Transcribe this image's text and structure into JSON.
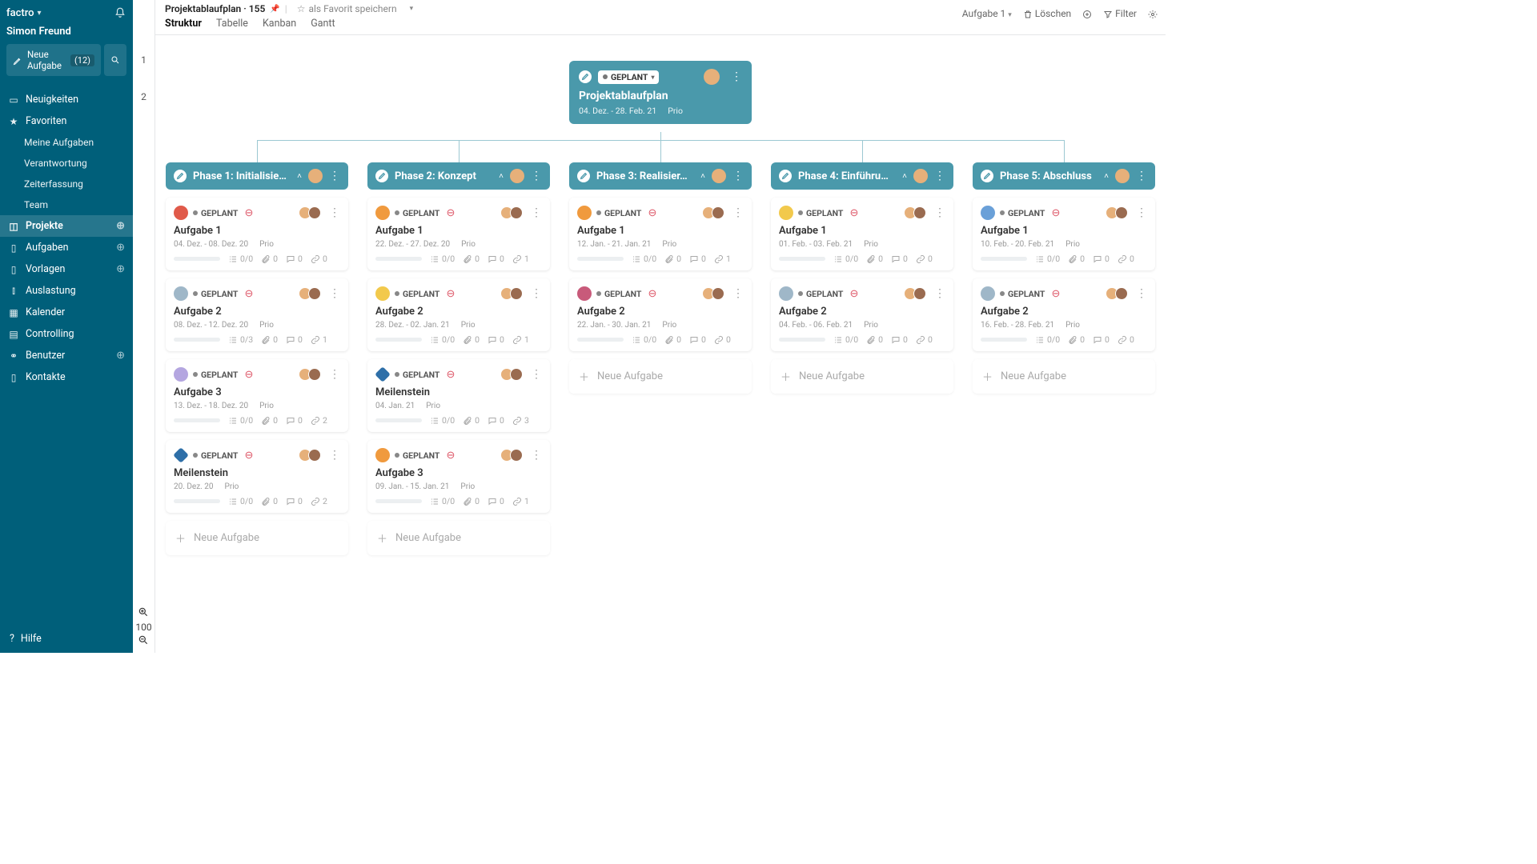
{
  "sidebar": {
    "brand": "factro",
    "user": "Simon Freund",
    "new_task": "Neue Aufgabe",
    "new_count": "(12)",
    "nav": {
      "neuigkeiten": "Neuigkeiten",
      "favoriten": "Favoriten",
      "meine": "Meine Aufgaben",
      "verantwortung": "Verantwortung",
      "zeit": "Zeiterfassung",
      "team": "Team",
      "projekte": "Projekte",
      "aufgaben": "Aufgaben",
      "vorlagen": "Vorlagen",
      "auslastung": "Auslastung",
      "kalender": "Kalender",
      "controlling": "Controlling",
      "benutzer": "Benutzer",
      "kontakte": "Kontakte"
    },
    "help": "Hilfe"
  },
  "ruler": {
    "r1": "1",
    "r2": "2",
    "zoom": "100"
  },
  "topbar": {
    "title": "Projektablaufplan · 155",
    "fav": "als Favorit speichern",
    "tabs": {
      "struktur": "Struktur",
      "tabelle": "Tabelle",
      "kanban": "Kanban",
      "gantt": "Gantt"
    },
    "task_label": "Aufgabe 1",
    "del": "Löschen",
    "filter": "Filter"
  },
  "root": {
    "status": "GEPLANT",
    "title": "Projektablaufplan",
    "dates": "04. Dez. - 28. Feb. 21",
    "prio": "Prio"
  },
  "status_label": "GEPLANT",
  "new_task_label": "Neue Aufgabe",
  "prio": "Prio",
  "phases": [
    {
      "title": "Phase 1: Initialisie…",
      "cards": [
        {
          "ico": "#e05a4a",
          "shape": "circle",
          "title": "Aufgabe 1",
          "dates": "04. Dez. - 08. Dez. 20",
          "sub": "0/0",
          "att": "0",
          "cmt": "0",
          "lnk": "0"
        },
        {
          "ico": "#9fb7c8",
          "shape": "circle",
          "title": "Aufgabe 2",
          "dates": "08. Dez. - 12. Dez. 20",
          "sub": "0/3",
          "att": "0",
          "cmt": "0",
          "lnk": "1"
        },
        {
          "ico": "#b4a6e0",
          "shape": "circle",
          "title": "Aufgabe 3",
          "dates": "13. Dez. - 18. Dez. 20",
          "sub": "0/0",
          "att": "0",
          "cmt": "0",
          "lnk": "2"
        },
        {
          "ico": "#2e6fa8",
          "shape": "diamond",
          "title": "Meilenstein",
          "dates": "20. Dez. 20",
          "sub": "0/0",
          "att": "0",
          "cmt": "0",
          "lnk": "2",
          "single_date": true
        }
      ]
    },
    {
      "title": "Phase 2: Konzept",
      "cards": [
        {
          "ico": "#f09a3e",
          "shape": "circle",
          "title": "Aufgabe 1",
          "dates": "22. Dez. - 27. Dez. 20",
          "sub": "0/0",
          "att": "0",
          "cmt": "0",
          "lnk": "1"
        },
        {
          "ico": "#f2c94c",
          "shape": "circle",
          "title": "Aufgabe 2",
          "dates": "28. Dez. - 02. Jan. 21",
          "sub": "0/0",
          "att": "0",
          "cmt": "0",
          "lnk": "1"
        },
        {
          "ico": "#2e6fa8",
          "shape": "diamond",
          "title": "Meilenstein",
          "dates": "04. Jan. 21",
          "sub": "0/0",
          "att": "0",
          "cmt": "0",
          "lnk": "3",
          "single_date": true
        },
        {
          "ico": "#f09a3e",
          "shape": "circle",
          "title": "Aufgabe 3",
          "dates": "09. Jan. - 15. Jan. 21",
          "sub": "0/0",
          "att": "0",
          "cmt": "0",
          "lnk": "1"
        }
      ]
    },
    {
      "title": "Phase 3: Realisier…",
      "cards": [
        {
          "ico": "#f09a3e",
          "shape": "circle",
          "title": "Aufgabe 1",
          "dates": "12. Jan. - 21. Jan. 21",
          "sub": "0/0",
          "att": "0",
          "cmt": "0",
          "lnk": "1"
        },
        {
          "ico": "#c85a7a",
          "shape": "circle",
          "title": "Aufgabe 2",
          "dates": "22. Jan. - 30. Jan. 21",
          "sub": "0/0",
          "att": "0",
          "cmt": "0",
          "lnk": "0"
        }
      ]
    },
    {
      "title": "Phase 4: Einführu…",
      "cards": [
        {
          "ico": "#f2c94c",
          "shape": "circle",
          "title": "Aufgabe 1",
          "dates": "01. Feb. - 03. Feb. 21",
          "sub": "0/0",
          "att": "0",
          "cmt": "0",
          "lnk": "0"
        },
        {
          "ico": "#9fb7c8",
          "shape": "circle",
          "title": "Aufgabe 2",
          "dates": "04. Feb. - 06. Feb. 21",
          "sub": "0/0",
          "att": "0",
          "cmt": "0",
          "lnk": "0"
        }
      ]
    },
    {
      "title": "Phase 5: Abschluss",
      "cards": [
        {
          "ico": "#6aa0d8",
          "shape": "circle",
          "title": "Aufgabe 1",
          "dates": "10. Feb. - 20. Feb. 21",
          "sub": "0/0",
          "att": "0",
          "cmt": "0",
          "lnk": "0"
        },
        {
          "ico": "#9fb7c8",
          "shape": "circle",
          "title": "Aufgabe 2",
          "dates": "16. Feb. - 28. Feb. 21",
          "sub": "0/0",
          "att": "0",
          "cmt": "0",
          "lnk": "0"
        }
      ]
    }
  ]
}
